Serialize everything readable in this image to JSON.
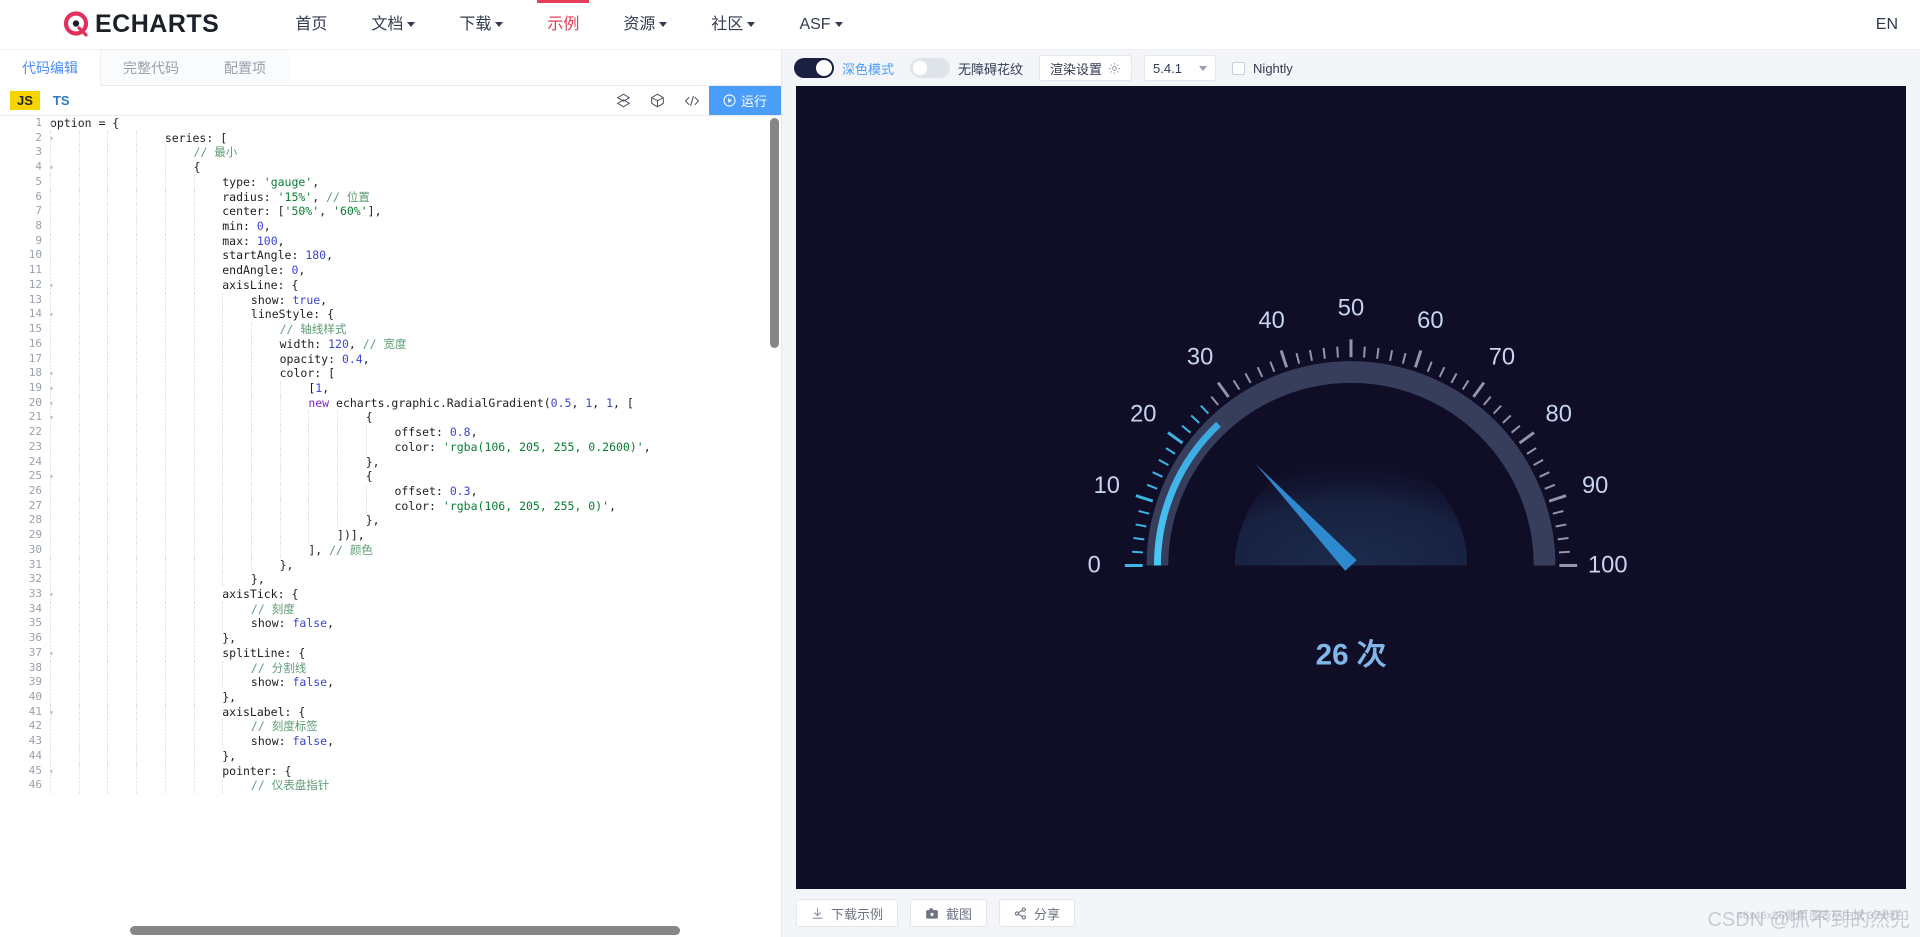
{
  "nav": {
    "brand": "ECHARTS",
    "items": [
      {
        "label": "首页",
        "dropdown": false,
        "active": false
      },
      {
        "label": "文档",
        "dropdown": true,
        "active": false
      },
      {
        "label": "下载",
        "dropdown": true,
        "active": false
      },
      {
        "label": "示例",
        "dropdown": false,
        "active": true
      },
      {
        "label": "资源",
        "dropdown": true,
        "active": false
      },
      {
        "label": "社区",
        "dropdown": true,
        "active": false
      },
      {
        "label": "ASF",
        "dropdown": true,
        "active": false
      }
    ],
    "lang": "EN"
  },
  "left": {
    "tabs": [
      {
        "label": "代码编辑",
        "active": true
      },
      {
        "label": "完整代码",
        "active": false
      },
      {
        "label": "配置项",
        "active": false
      }
    ],
    "toolbar": {
      "js_label": "JS",
      "ts_label": "TS",
      "run_label": "运行",
      "icons": [
        "cube-gradient-icon",
        "cube-outline-icon",
        "code-brackets-icon",
        "play-circle-icon"
      ]
    },
    "code_lines": [
      {
        "n": 1,
        "fold": true,
        "indent": 0,
        "tokens": [
          [
            "pln",
            "option = {"
          ]
        ]
      },
      {
        "n": 2,
        "fold": true,
        "indent": 4,
        "tokens": [
          [
            "pln",
            "series: ["
          ]
        ]
      },
      {
        "n": 3,
        "fold": false,
        "indent": 5,
        "tokens": [
          [
            "com",
            "// 最小"
          ]
        ]
      },
      {
        "n": 4,
        "fold": true,
        "indent": 5,
        "tokens": [
          [
            "pln",
            "{"
          ]
        ]
      },
      {
        "n": 5,
        "fold": false,
        "indent": 6,
        "tokens": [
          [
            "pln",
            "type: "
          ],
          [
            "str",
            "'gauge'"
          ],
          [
            "pln",
            ","
          ]
        ]
      },
      {
        "n": 6,
        "fold": false,
        "indent": 6,
        "tokens": [
          [
            "pln",
            "radius: "
          ],
          [
            "str",
            "'15%'"
          ],
          [
            "pln",
            ", "
          ],
          [
            "com",
            "// 位置"
          ]
        ]
      },
      {
        "n": 7,
        "fold": false,
        "indent": 6,
        "tokens": [
          [
            "pln",
            "center: ["
          ],
          [
            "str",
            "'50%'"
          ],
          [
            "pln",
            ", "
          ],
          [
            "str",
            "'60%'"
          ],
          [
            "pln",
            "],"
          ]
        ]
      },
      {
        "n": 8,
        "fold": false,
        "indent": 6,
        "tokens": [
          [
            "pln",
            "min: "
          ],
          [
            "num",
            "0"
          ],
          [
            "pln",
            ","
          ]
        ]
      },
      {
        "n": 9,
        "fold": false,
        "indent": 6,
        "tokens": [
          [
            "pln",
            "max: "
          ],
          [
            "num",
            "100"
          ],
          [
            "pln",
            ","
          ]
        ]
      },
      {
        "n": 10,
        "fold": false,
        "indent": 6,
        "tokens": [
          [
            "pln",
            "startAngle: "
          ],
          [
            "num",
            "180"
          ],
          [
            "pln",
            ","
          ]
        ]
      },
      {
        "n": 11,
        "fold": false,
        "indent": 6,
        "tokens": [
          [
            "pln",
            "endAngle: "
          ],
          [
            "num",
            "0"
          ],
          [
            "pln",
            ","
          ]
        ]
      },
      {
        "n": 12,
        "fold": true,
        "indent": 6,
        "tokens": [
          [
            "pln",
            "axisLine: {"
          ]
        ]
      },
      {
        "n": 13,
        "fold": false,
        "indent": 7,
        "tokens": [
          [
            "pln",
            "show: "
          ],
          [
            "bool",
            "true"
          ],
          [
            "pln",
            ","
          ]
        ]
      },
      {
        "n": 14,
        "fold": true,
        "indent": 7,
        "tokens": [
          [
            "pln",
            "lineStyle: {"
          ]
        ]
      },
      {
        "n": 15,
        "fold": false,
        "indent": 8,
        "tokens": [
          [
            "com",
            "// 轴线样式"
          ]
        ]
      },
      {
        "n": 16,
        "fold": false,
        "indent": 8,
        "tokens": [
          [
            "pln",
            "width: "
          ],
          [
            "num",
            "120"
          ],
          [
            "pln",
            ", "
          ],
          [
            "com",
            "// 宽度"
          ]
        ]
      },
      {
        "n": 17,
        "fold": false,
        "indent": 8,
        "tokens": [
          [
            "pln",
            "opacity: "
          ],
          [
            "num",
            "0.4"
          ],
          [
            "pln",
            ","
          ]
        ]
      },
      {
        "n": 18,
        "fold": true,
        "indent": 8,
        "tokens": [
          [
            "pln",
            "color: ["
          ]
        ]
      },
      {
        "n": 19,
        "fold": true,
        "indent": 9,
        "tokens": [
          [
            "pln",
            "["
          ],
          [
            "num",
            "1"
          ],
          [
            "pln",
            ","
          ]
        ]
      },
      {
        "n": 20,
        "fold": true,
        "indent": 9,
        "tokens": [
          [
            "kw",
            "new"
          ],
          [
            "pln",
            " echarts.graphic.RadialGradient("
          ],
          [
            "num",
            "0.5"
          ],
          [
            "pln",
            ", "
          ],
          [
            "num",
            "1"
          ],
          [
            "pln",
            ", "
          ],
          [
            "num",
            "1"
          ],
          [
            "pln",
            ", ["
          ]
        ]
      },
      {
        "n": 21,
        "fold": true,
        "indent": 11,
        "tokens": [
          [
            "pln",
            "{"
          ]
        ]
      },
      {
        "n": 22,
        "fold": false,
        "indent": 12,
        "tokens": [
          [
            "pln",
            "offset: "
          ],
          [
            "num",
            "0.8"
          ],
          [
            "pln",
            ","
          ]
        ]
      },
      {
        "n": 23,
        "fold": false,
        "indent": 12,
        "tokens": [
          [
            "pln",
            "color: "
          ],
          [
            "str",
            "'rgba(106, 205, 255, 0.2600)'"
          ],
          [
            "pln",
            ","
          ]
        ]
      },
      {
        "n": 24,
        "fold": false,
        "indent": 11,
        "tokens": [
          [
            "pln",
            "},"
          ]
        ]
      },
      {
        "n": 25,
        "fold": true,
        "indent": 11,
        "tokens": [
          [
            "pln",
            "{"
          ]
        ]
      },
      {
        "n": 26,
        "fold": false,
        "indent": 12,
        "tokens": [
          [
            "pln",
            "offset: "
          ],
          [
            "num",
            "0.3"
          ],
          [
            "pln",
            ","
          ]
        ]
      },
      {
        "n": 27,
        "fold": false,
        "indent": 12,
        "tokens": [
          [
            "pln",
            "color: "
          ],
          [
            "str",
            "'rgba(106, 205, 255, 0)'"
          ],
          [
            "pln",
            ","
          ]
        ]
      },
      {
        "n": 28,
        "fold": false,
        "indent": 11,
        "tokens": [
          [
            "pln",
            "},"
          ]
        ]
      },
      {
        "n": 29,
        "fold": false,
        "indent": 10,
        "tokens": [
          [
            "pln",
            "])],"
          ]
        ]
      },
      {
        "n": 30,
        "fold": false,
        "indent": 9,
        "tokens": [
          [
            "pln",
            "], "
          ],
          [
            "com",
            "// 颜色"
          ]
        ]
      },
      {
        "n": 31,
        "fold": false,
        "indent": 8,
        "tokens": [
          [
            "pln",
            "},"
          ]
        ]
      },
      {
        "n": 32,
        "fold": false,
        "indent": 7,
        "tokens": [
          [
            "pln",
            "},"
          ]
        ]
      },
      {
        "n": 33,
        "fold": true,
        "indent": 6,
        "tokens": [
          [
            "pln",
            "axisTick: {"
          ]
        ]
      },
      {
        "n": 34,
        "fold": false,
        "indent": 7,
        "tokens": [
          [
            "com",
            "// 刻度"
          ]
        ]
      },
      {
        "n": 35,
        "fold": false,
        "indent": 7,
        "tokens": [
          [
            "pln",
            "show: "
          ],
          [
            "bool",
            "false"
          ],
          [
            "pln",
            ","
          ]
        ]
      },
      {
        "n": 36,
        "fold": false,
        "indent": 6,
        "tokens": [
          [
            "pln",
            "},"
          ]
        ]
      },
      {
        "n": 37,
        "fold": true,
        "indent": 6,
        "tokens": [
          [
            "pln",
            "splitLine: {"
          ]
        ]
      },
      {
        "n": 38,
        "fold": false,
        "indent": 7,
        "tokens": [
          [
            "com",
            "// 分割线"
          ]
        ]
      },
      {
        "n": 39,
        "fold": false,
        "indent": 7,
        "tokens": [
          [
            "pln",
            "show: "
          ],
          [
            "bool",
            "false"
          ],
          [
            "pln",
            ","
          ]
        ]
      },
      {
        "n": 40,
        "fold": false,
        "indent": 6,
        "tokens": [
          [
            "pln",
            "},"
          ]
        ]
      },
      {
        "n": 41,
        "fold": true,
        "indent": 6,
        "tokens": [
          [
            "pln",
            "axisLabel: {"
          ]
        ]
      },
      {
        "n": 42,
        "fold": false,
        "indent": 7,
        "tokens": [
          [
            "com",
            "// 刻度标签"
          ]
        ]
      },
      {
        "n": 43,
        "fold": false,
        "indent": 7,
        "tokens": [
          [
            "pln",
            "show: "
          ],
          [
            "bool",
            "false"
          ],
          [
            "pln",
            ","
          ]
        ]
      },
      {
        "n": 44,
        "fold": false,
        "indent": 6,
        "tokens": [
          [
            "pln",
            "},"
          ]
        ]
      },
      {
        "n": 45,
        "fold": true,
        "indent": 6,
        "tokens": [
          [
            "pln",
            "pointer: {"
          ]
        ]
      },
      {
        "n": 46,
        "fold": false,
        "indent": 7,
        "tokens": [
          [
            "com",
            "// 仪表盘指针"
          ]
        ]
      }
    ]
  },
  "right": {
    "dark_mode": {
      "label": "深色模式",
      "on": true
    },
    "pattern": {
      "label": "无障碍花纹",
      "on": false
    },
    "render_settings_label": "渲染设置",
    "version": "5.4.1",
    "nightly_label": "Nightly",
    "nightly_checked": false,
    "footer_buttons": [
      {
        "label": "下载示例",
        "icon": "download-icon"
      },
      {
        "label": "截图",
        "icon": "camera-icon"
      },
      {
        "label": "分享",
        "icon": "share-icon"
      }
    ],
    "render_time": "46x46x26像素 图表已生成 3.50秒",
    "watermark": "CSDN @抓不到的然兜"
  },
  "chart_data": {
    "type": "gauge",
    "title": "",
    "value": 26,
    "value_label": "26 次",
    "min": 0,
    "max": 100,
    "start_angle": 180,
    "end_angle": 0,
    "tick_labels": [
      0,
      10,
      20,
      30,
      40,
      50,
      60,
      70,
      80,
      90,
      100
    ],
    "split_number": 10,
    "minor_ticks_per_split": 5,
    "background_color": "#100d26",
    "progress_color": "#3ec1f0",
    "track_color": "#39415f",
    "axis_label_color": "#c8d4f0",
    "value_text_color": "#7fb7e8",
    "pointer_color": "#2f8fd6",
    "inner_dome_color": "#16203c",
    "radius_percent": "15%",
    "center": [
      "50%",
      "60%"
    ],
    "axis_line_width": 120,
    "axis_line_opacity": 0.4,
    "gradient_stops": [
      {
        "offset": 0.8,
        "color": "rgba(106, 205, 255, 0.2600)"
      },
      {
        "offset": 0.3,
        "color": "rgba(106, 205, 255, 0)"
      }
    ]
  }
}
